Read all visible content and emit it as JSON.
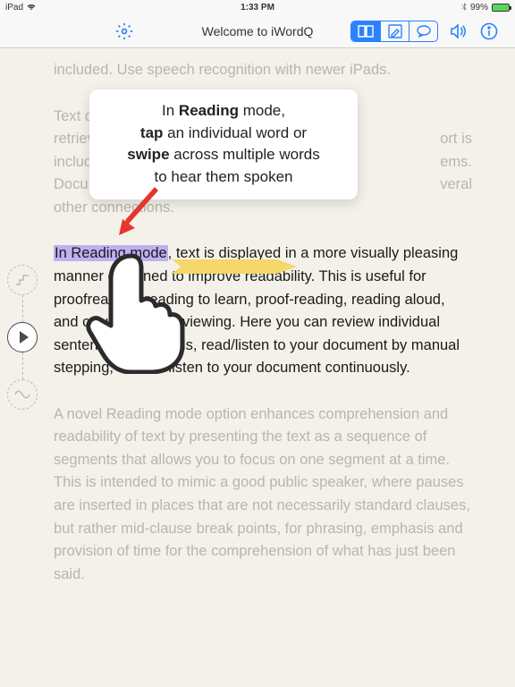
{
  "status": {
    "device": "iPad",
    "time": "1:33 PM",
    "battery_pct": "99%"
  },
  "nav": {
    "title": "Welcome to iWordQ"
  },
  "tooltip": {
    "line1_pre": "In ",
    "line1_b": "Reading",
    "line1_post": " mode,",
    "line2_b": "tap",
    "line2_post": " an individual word or",
    "line3_b": "swipe",
    "line3_post": " across multiple words",
    "line4": "to hear them spoken"
  },
  "paragraphs": {
    "p1": "included. Use speech recognition with newer iPads.",
    "p2_line1": "Text d",
    "p2_line2": "retriev",
    "p2_line2_tail": "ort is",
    "p2_line3": "includ",
    "p2_line3_tail": "ems.",
    "p2_line4": "Docu",
    "p2_line4_tail": "veral",
    "p2_line5": "other connections.",
    "p3_highlight": "In Reading mode",
    "p3_rest1": ", text is displayed in a more visually pleasing manner designed to improve readability. This is useful for proofreading, reading to learn, proof-reading, reading aloud, and casual reading viewing. Here you can review individual sentences and words, read/listen to your document by manual stepping, or read/listen to your document continuously.",
    "p4": "A novel Reading mode option enhances comprehension and readability of text by presenting the text as a sequence of segments that allows you to focus on one segment at a time. This is intended to mimic a good public speaker, where pauses are inserted in places that are not necessarily standard clauses, but rather mid-clause break points, for phrasing, emphasis and provision of time for the comprehension of what has just been said."
  }
}
